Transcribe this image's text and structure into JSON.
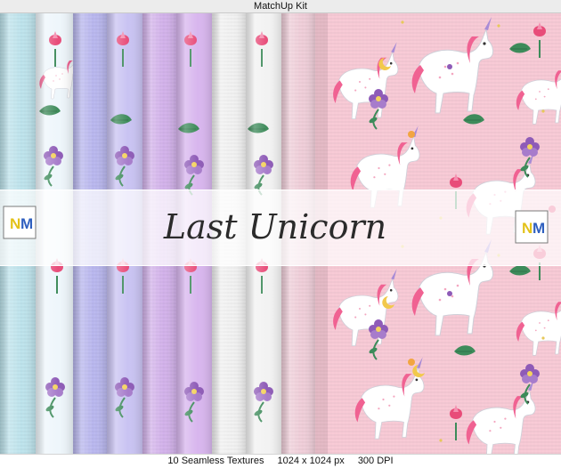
{
  "window": {
    "title": "MatchUp Kit"
  },
  "banner": {
    "title": "Last Unicorn",
    "logo_text_n": "N",
    "logo_text_m": "M"
  },
  "footer": {
    "count": "10 Seamless Textures",
    "size": "1024 x 1024 px",
    "dpi": "300 DPI"
  },
  "colors": {
    "titlebar": "#ececec",
    "pink_bg": "#f7c9d5",
    "lavender": "#b8b6ee",
    "light_blue": "#bde3ec",
    "lilac": "#d2b1ea",
    "white_paper": "#f1f1f1",
    "light_pink": "#efcdd8",
    "unicorn_mane": "#f06292",
    "leaf_green": "#3d8b5a",
    "flower_purple": "#8e5bb7",
    "logo_blue": "#2f5fbf",
    "logo_yellow": "#e3c21a"
  },
  "paper_strips": [
    {
      "kind": "plain",
      "color_key": "light_blue"
    },
    {
      "kind": "pattern",
      "bg": "#eef6fb"
    },
    {
      "kind": "plain",
      "color_key": "lavender"
    },
    {
      "kind": "pattern",
      "bg": "#c9c3f2"
    },
    {
      "kind": "plain",
      "color_key": "lilac"
    },
    {
      "kind": "pattern",
      "bg": "#d8b6ee"
    },
    {
      "kind": "plain",
      "color_key": "white_paper"
    },
    {
      "kind": "pattern",
      "bg": "#f2f2f2"
    },
    {
      "kind": "plain",
      "color_key": "light_pink"
    }
  ]
}
